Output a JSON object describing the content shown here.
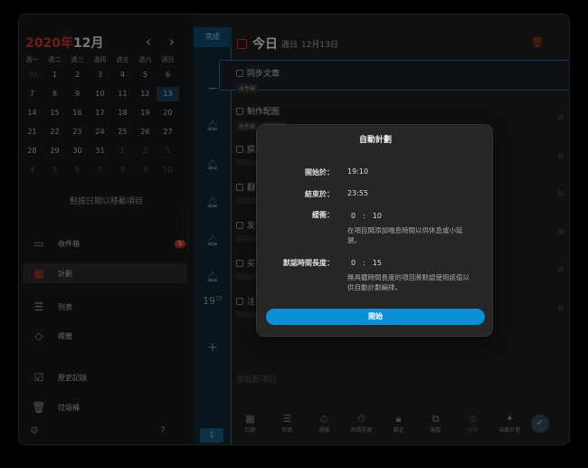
{
  "calendar": {
    "year": "2020年",
    "month": "12月",
    "prev": "‹",
    "next": "›",
    "weekdays": [
      "週一",
      "週二",
      "週三",
      "週四",
      "週五",
      "週六",
      "週日"
    ],
    "weeks": [
      [
        "30",
        "1",
        "2",
        "3",
        "4",
        "5",
        "6"
      ],
      [
        "7",
        "8",
        "9",
        "10",
        "11",
        "12",
        "13"
      ],
      [
        "14",
        "15",
        "16",
        "17",
        "18",
        "19",
        "20"
      ],
      [
        "21",
        "22",
        "23",
        "24",
        "25",
        "26",
        "27"
      ],
      [
        "28",
        "29",
        "30",
        "31",
        "1",
        "2",
        "3"
      ],
      [
        "4",
        "5",
        "6",
        "7",
        "8",
        "9",
        "10"
      ]
    ],
    "hint": "點按日期以移動項目"
  },
  "sidebar": {
    "items": [
      {
        "label": "收件箱",
        "icon": "inbox-icon",
        "badge": "5"
      },
      {
        "label": "計劃",
        "icon": "calendar-icon"
      },
      {
        "label": "列表",
        "icon": "list-icon"
      },
      {
        "label": "標籤",
        "icon": "tag-icon"
      },
      {
        "label": "歷史記錄",
        "icon": "history-icon"
      },
      {
        "label": "垃圾桶",
        "icon": "trash-icon"
      }
    ]
  },
  "timeline": {
    "done_label": "完成",
    "minus": "−",
    "time_hour": "19",
    "time_minute": "15",
    "add": "+",
    "bottom_count": "1"
  },
  "main": {
    "title": "今日",
    "weekday": "週日",
    "date": "12月13日",
    "tasks": [
      {
        "title": "同步文章",
        "tags": [
          "收件箱"
        ]
      },
      {
        "title": "制作配图",
        "tags": [
          "收件箱",
          "Update"
        ]
      },
      {
        "title": "撰",
        "tags": []
      },
      {
        "title": "翻",
        "tags": []
      },
      {
        "title": "发",
        "tags": []
      },
      {
        "title": "买",
        "tags": []
      },
      {
        "title": "注",
        "tags": []
      }
    ],
    "add_task": "添加新項目"
  },
  "toolbar": {
    "items": [
      {
        "label": "日期",
        "icon": "calendar-icon"
      },
      {
        "label": "列表",
        "icon": "list-icon"
      },
      {
        "label": "標籤",
        "icon": "tag-icon"
      },
      {
        "label": "時間長度",
        "icon": "timer-icon"
      },
      {
        "label": "鎖定",
        "icon": "lock-icon"
      },
      {
        "label": "複製",
        "icon": "duplicate-icon"
      },
      {
        "label": "移除",
        "icon": "remove-icon"
      },
      {
        "label": "自動計劃",
        "icon": "magic-wand-icon"
      }
    ]
  },
  "dialog": {
    "title": "自動計劃",
    "start_label": "開始於：",
    "start_value": "19:10",
    "end_label": "結束於：",
    "end_value": "23:55",
    "buffer_label": "緩衝：",
    "buffer_hours": "0",
    "buffer_sep": ":",
    "buffer_minutes": "10",
    "buffer_desc": "在項目間添加喘息時間以供休息或小延遲。",
    "default_label": "默認時間長度：",
    "default_hours": "0",
    "default_sep": ":",
    "default_minutes": "15",
    "default_desc": "無具體時間長度的項目將默認使用該值以供自動計劃編排。",
    "start_button": "開始"
  },
  "colors": {
    "accent": "#0b8fd6",
    "red": "#c0392b",
    "timeline": "#124a6b"
  }
}
